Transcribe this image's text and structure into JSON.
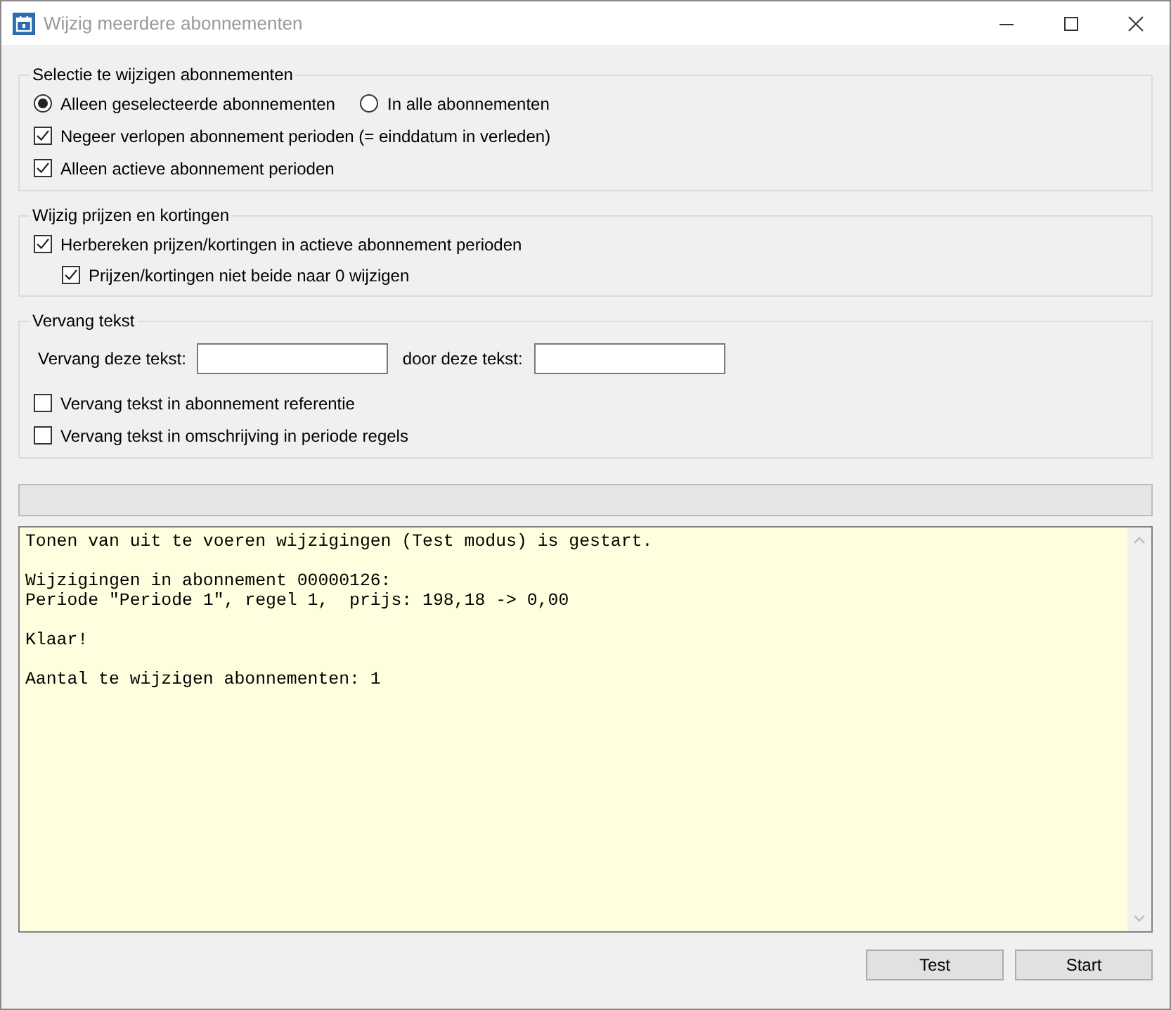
{
  "window": {
    "title": "Wijzig meerdere abonnementen",
    "active": false
  },
  "groups": [
    {
      "title": "Selectie te wijzigen abonnementen",
      "items": [
        {
          "kind": "radios",
          "options": [
            {
              "label": "Alleen geselecteerde abonnementen",
              "selected": true
            },
            {
              "label": "In alle abonnementen",
              "selected": false
            }
          ]
        },
        {
          "kind": "checkbox",
          "label": "Negeer verlopen abonnement perioden (= einddatum in verleden)",
          "checked": true
        },
        {
          "kind": "checkbox",
          "label": "Alleen actieve abonnement perioden",
          "checked": true
        }
      ]
    },
    {
      "title": "Wijzig prijzen en kortingen",
      "items": [
        {
          "kind": "checkbox",
          "label": "Herbereken prijzen/kortingen in actieve abonnement perioden",
          "checked": true,
          "children": [
            {
              "label": "Prijzen/kortingen niet beide naar 0 wijzigen",
              "checked": true
            }
          ]
        }
      ]
    },
    {
      "title": "Vervang tekst",
      "items": [
        {
          "kind": "fields",
          "fields": [
            {
              "label": "Vervang deze tekst:"
            },
            {
              "label": "door deze tekst:"
            }
          ]
        },
        {
          "kind": "checkbox",
          "label": "Vervang tekst in abonnement referentie",
          "checked": false
        },
        {
          "kind": "checkbox",
          "label": "Vervang tekst in omschrijving in periode regels",
          "checked": false
        }
      ]
    }
  ],
  "progress": {
    "level": 0
  },
  "log": [
    [
      "Tonen van uit te voeren wijzigingen (Test modus) is gestart."
    ],
    [
      "Wijzigingen in abonnement 00000126:",
      "Periode \"Periode 1\", regel 1,  prijs: 198,18 -> 0,00"
    ],
    [
      "Klaar!"
    ],
    [
      "Aantal te wijzigen abonnementen: 1"
    ]
  ],
  "buttons": [
    "Test",
    "Start"
  ]
}
